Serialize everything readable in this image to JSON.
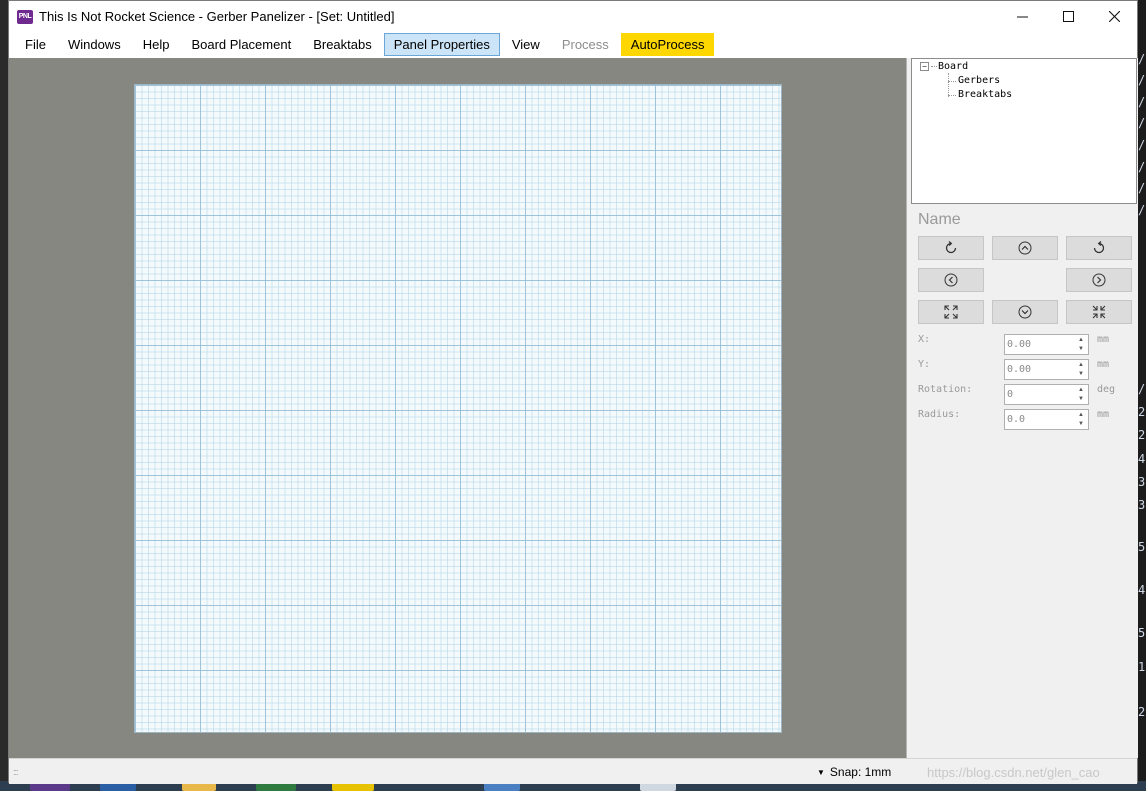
{
  "window": {
    "title": "This Is Not Rocket Science - Gerber Panelizer - [Set: Untitled]",
    "icon_text": "PNL",
    "controls": [
      "minimize-icon",
      "maximize-icon",
      "close-icon"
    ]
  },
  "menu": {
    "items": [
      {
        "label": "File",
        "state": "normal"
      },
      {
        "label": "Windows",
        "state": "normal"
      },
      {
        "label": "Help",
        "state": "normal"
      },
      {
        "label": "Board Placement",
        "state": "normal"
      },
      {
        "label": "Breaktabs",
        "state": "normal"
      },
      {
        "label": "Panel Properties",
        "state": "active"
      },
      {
        "label": "View",
        "state": "normal"
      },
      {
        "label": "Process",
        "state": "disabled"
      },
      {
        "label": "AutoProcess",
        "state": "highlight"
      }
    ]
  },
  "tree": {
    "root": "Board",
    "expander": "−",
    "children": [
      "Gerbers",
      "Breaktabs"
    ]
  },
  "props": {
    "name_label": "Name",
    "buttons": [
      "rotate-ccw-icon",
      "move-up-icon",
      "rotate-cw-icon",
      "move-left-icon",
      "move-right-icon",
      "expand-icon",
      "move-down-icon",
      "contract-icon"
    ],
    "fields": [
      {
        "label": "X:",
        "value": "0.00",
        "unit": "mm"
      },
      {
        "label": "Y:",
        "value": "0.00",
        "unit": "mm"
      },
      {
        "label": "Rotation:",
        "value": "0",
        "unit": "deg"
      },
      {
        "label": "Radius:",
        "value": "0.0",
        "unit": "mm"
      }
    ]
  },
  "status": {
    "grip": ":::",
    "snap": "Snap: 1mm",
    "watermark": "https://blog.csdn.net/glen_cao"
  },
  "colors": {
    "accent_active": "#cce4f7",
    "highlight": "#ffd700",
    "canvas_bg": "#878782",
    "grid_bg": "#f4f9fb"
  }
}
